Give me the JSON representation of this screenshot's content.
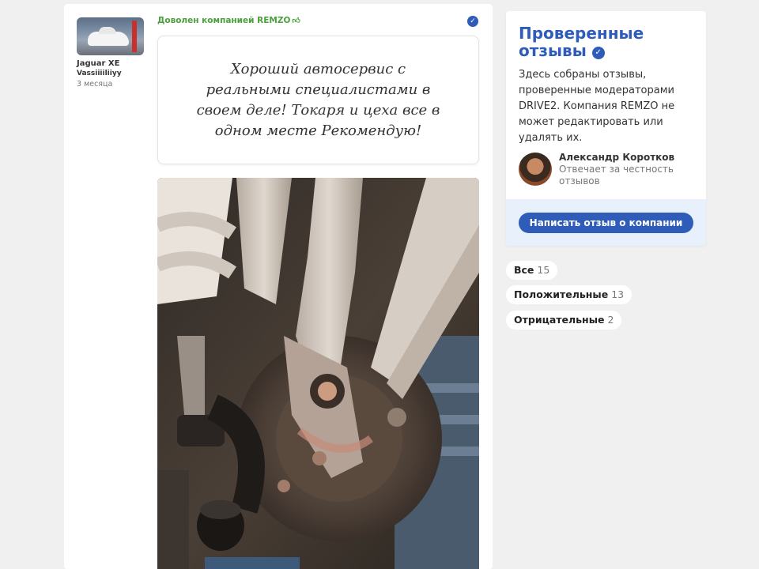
{
  "review": {
    "author_car": "Jaguar XE",
    "author_nick": "Vassiiiiliiyy",
    "date": "3 месяца",
    "satisfied_label": "Доволен компанией REMZO",
    "text": "Хороший автосервис с реальными специалистами в своем деле! Токаря и цеха все в одном месте Рекомендую!"
  },
  "sidebar": {
    "title": "Проверенные отзывы",
    "description": "Здесь собраны отзывы, проверенные модераторами DRIVE2. Компания REMZO не может редактировать или удалять их.",
    "moderator_name": "Александр Коротков",
    "moderator_role": "Отвечает за честность отзывов",
    "write_button": "Написать отзыв о компании"
  },
  "filters": [
    {
      "label": "Все",
      "count": "15"
    },
    {
      "label": "Положительные",
      "count": "13"
    },
    {
      "label": "Отрицательные",
      "count": "2"
    }
  ],
  "icons": {
    "thumb": "thumbs-up-icon",
    "verified": "checkmark-verified-icon"
  },
  "colors": {
    "accent": "#2e5cb8",
    "positive": "#4aa13c"
  }
}
